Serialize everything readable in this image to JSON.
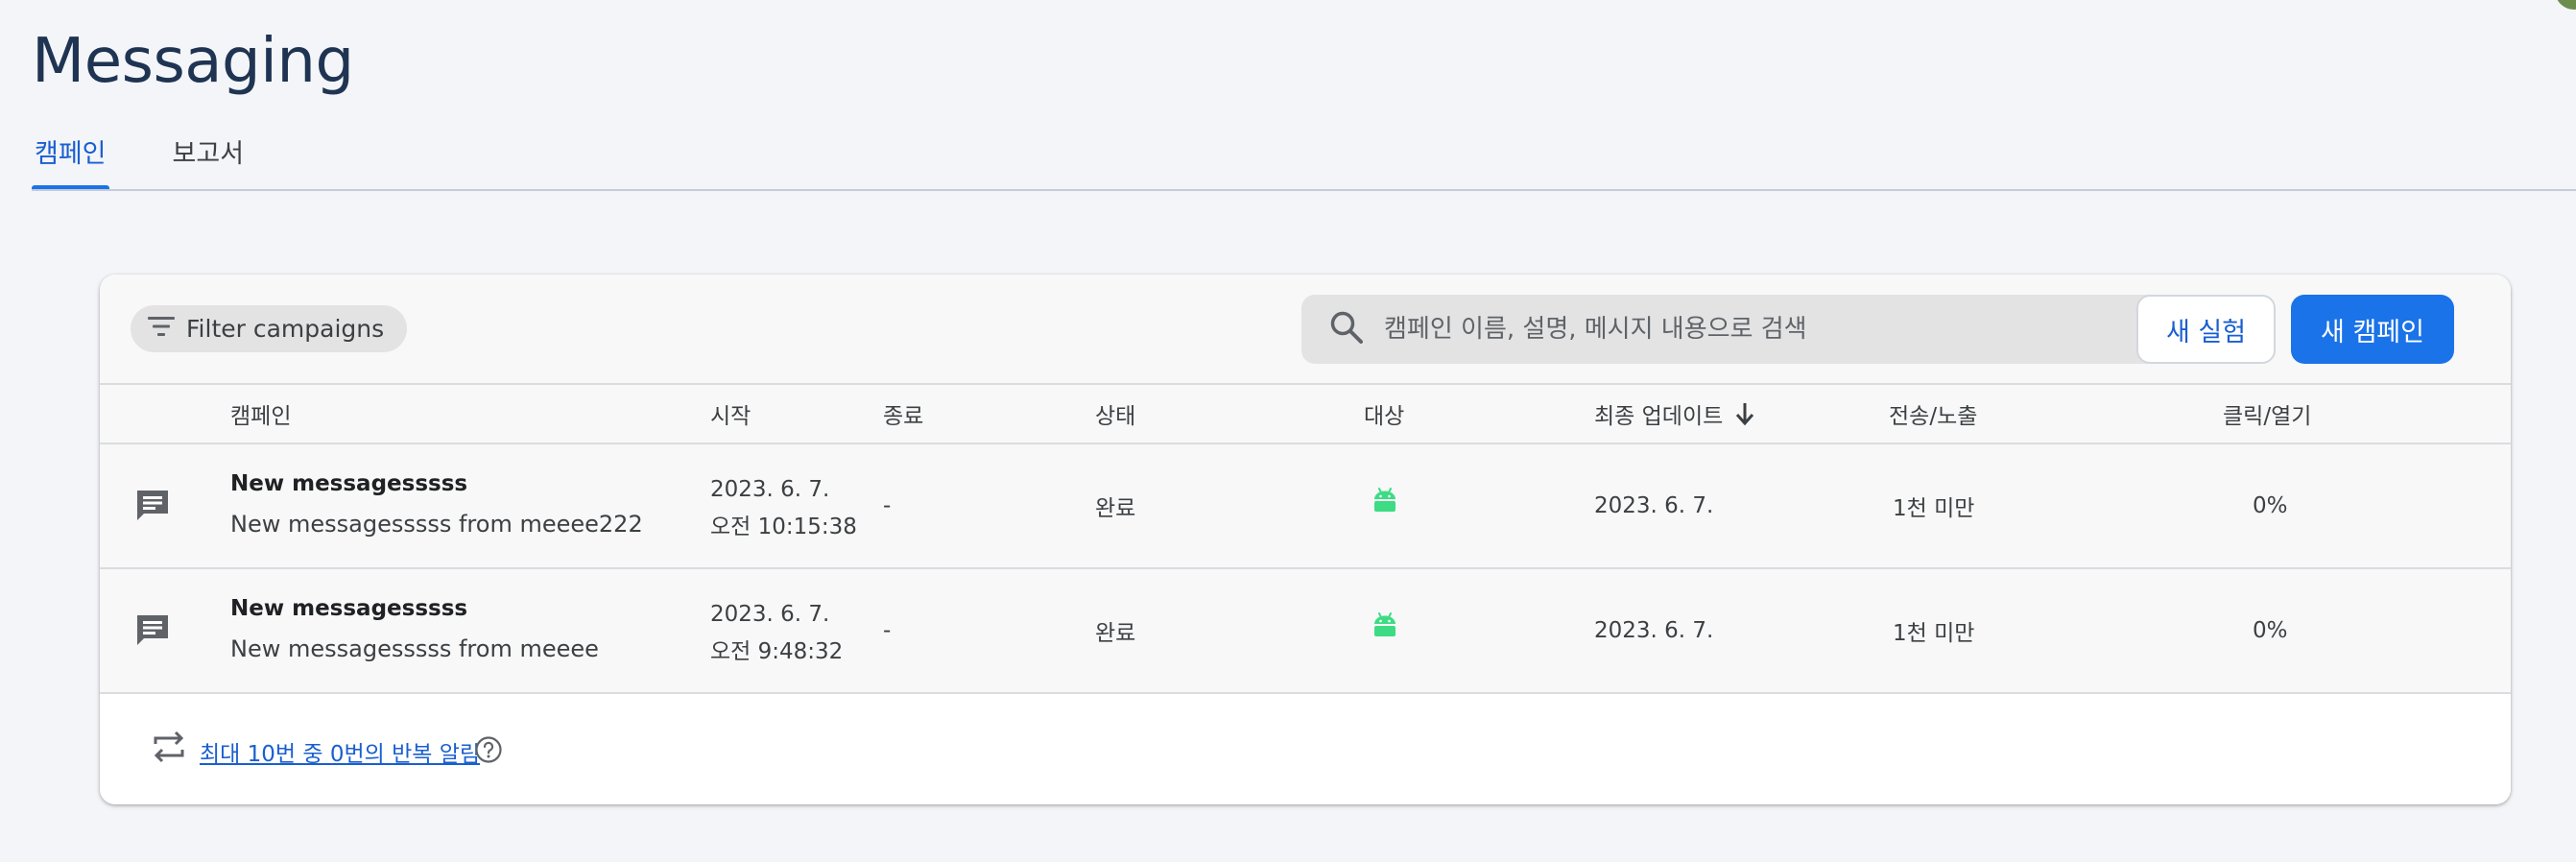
{
  "page": {
    "title": "Messaging"
  },
  "tabs": [
    {
      "label": "캠페인",
      "active": true
    },
    {
      "label": "보고서",
      "active": false
    }
  ],
  "toolbar": {
    "filter_label": "Filter campaigns",
    "search_placeholder": "캠페인 이름, 설명, 메시지 내용으로 검색",
    "experiment_button": "새 실험",
    "new_campaign_button": "새 캠페인"
  },
  "table": {
    "columns": [
      "캠페인",
      "시작",
      "종료",
      "상태",
      "대상",
      "최종 업데이트",
      "전송/노출",
      "클릭/열기"
    ],
    "sorted_column": "최종 업데이트",
    "sort_direction": "descending",
    "rows": [
      {
        "icon": "message-icon",
        "title": "New messagesssss",
        "subtitle": "New messagesssss from meeee222",
        "start_date": "2023. 6. 7.",
        "start_time": "오전 10:15:38",
        "end": "-",
        "status": "완료",
        "target_icon": "android-icon",
        "last_updated": "2023. 6. 7.",
        "sends": "1천 미만",
        "clicks": "0%"
      },
      {
        "icon": "message-icon",
        "title": "New messagesssss",
        "subtitle": "New messagesssss from meeee",
        "start_date": "2023. 6. 7.",
        "start_time": "오전 9:48:32",
        "end": "-",
        "status": "완료",
        "target_icon": "android-icon",
        "last_updated": "2023. 6. 7.",
        "sends": "1천 미만",
        "clicks": "0%"
      }
    ]
  },
  "footer": {
    "repeat_notice": "최대 10번 중 0번의 반복 알림"
  },
  "colors": {
    "accent": "#1a73e8",
    "title": "#1f3452",
    "android": "#3ddc84",
    "background": "#f4f5f8"
  }
}
